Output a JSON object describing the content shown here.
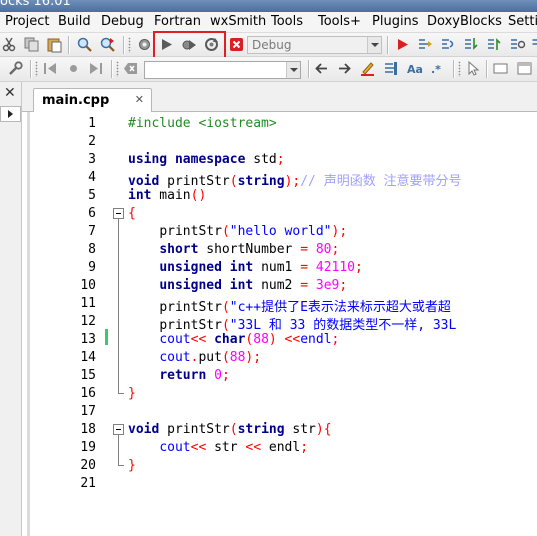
{
  "title_fragment": "ocks 16.01",
  "menu": [
    "Project",
    "Build",
    "Debug",
    "Fortran",
    "wxSmith",
    "Tools",
    "Tools+",
    "Plugins",
    "DoxyBlocks",
    "Settin"
  ],
  "toolbar": {
    "build_target": "Debug",
    "search_combo": ""
  },
  "tab": {
    "label": "main.cpp",
    "close": "✕"
  },
  "left_panel": {
    "close": "✕"
  },
  "line_numbers": [
    "1",
    "2",
    "3",
    "4",
    "5",
    "6",
    "7",
    "8",
    "9",
    "10",
    "11",
    "12",
    "13",
    "14",
    "15",
    "16",
    "17",
    "18",
    "19",
    "20",
    "21"
  ],
  "code": {
    "l1_pp": "#include <iostream>",
    "l3_kw1": "using",
    "l3_kw2": "namespace",
    "l3_id": " std",
    "l4_kw": "void",
    "l4_id": " printStr",
    "l4_kw2": "string",
    "l4_cm": "// 声明函数 注意要带分号",
    "l5_kw": "int",
    "l5_id": " main",
    "l7_id": "printStr",
    "l7_str": "\"hello world\"",
    "l8_kw": "short",
    "l8_id": " shortNumber ",
    "l8_num": "80",
    "l9_kw": "unsigned",
    "l9_kw2": "int",
    "l9_id": " num1 ",
    "l9_num": "42110",
    "l10_kw": "unsigned",
    "l10_kw2": "int",
    "l10_id": " num2 ",
    "l10_num": "3e9",
    "l11_id": "printStr",
    "l11_str": "\"c++提供了E表示法来标示超大或者超",
    "l12_id": "printStr",
    "l12_str": "\"33L 和 33 的数据类型不一样, 33L",
    "l13_cout": "cout",
    "l13_kw": "char",
    "l13_num": "88",
    "l13_endl": "endl",
    "l14_cout": "cout",
    "l14_put": "put",
    "l14_num": "88",
    "l15_kw": "return",
    "l15_num": "0",
    "l18_kw": "void",
    "l18_id": "printStr",
    "l18_kw2": "string",
    "l18_id2": " str",
    "l19_cout": "cout",
    "l19_id": " str ",
    "l19_endl": " endl"
  },
  "colors": {
    "keyword": "#00008b",
    "string": "#0000ff",
    "number": "#ff00ff",
    "operator": "#ff0000",
    "preprocessor": "#238b23",
    "comment": "#a0a0ff",
    "highlight_box": "#e02020"
  }
}
